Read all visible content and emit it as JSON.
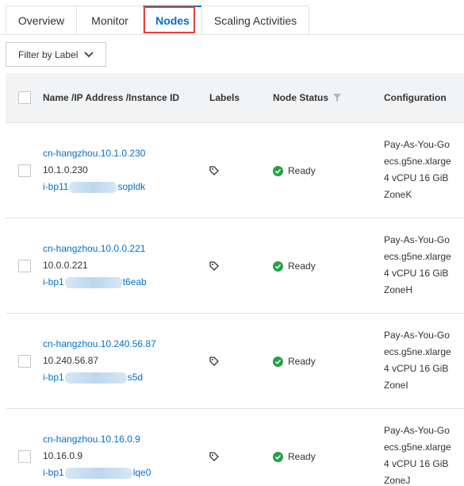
{
  "tabs": [
    {
      "label": "Overview"
    },
    {
      "label": "Monitor"
    },
    {
      "label": "Nodes",
      "active": true
    },
    {
      "label": "Scaling Activities"
    }
  ],
  "filter": {
    "label": "Filter by Label"
  },
  "columns": {
    "name": "Name /IP Address /Instance ID",
    "labels": "Labels",
    "status": "Node Status",
    "config": "Configuration"
  },
  "rows": [
    {
      "name": "cn-hangzhou.10.1.0.230",
      "ip": "10.1.0.230",
      "instance_prefix": "i-bp11",
      "instance_suffix": "sopldk",
      "status": "Ready",
      "config": [
        "Pay-As-You-Go",
        "ecs.g5ne.xlarge",
        "4 vCPU 16 GiB",
        "ZoneK"
      ]
    },
    {
      "name": "cn-hangzhou.10.0.0.221",
      "ip": "10.0.0.221",
      "instance_prefix": "i-bp1",
      "instance_suffix": "t6eab",
      "status": "Ready",
      "config": [
        "Pay-As-You-Go",
        "ecs.g5ne.xlarge",
        "4 vCPU 16 GiB",
        "ZoneH"
      ]
    },
    {
      "name": "cn-hangzhou.10.240.56.87",
      "ip": "10.240.56.87",
      "instance_prefix": "i-bp1",
      "instance_suffix": "s5d",
      "status": "Ready",
      "config": [
        "Pay-As-You-Go",
        "ecs.g5ne.xlarge",
        "4 vCPU 16 GiB",
        "ZoneI"
      ]
    },
    {
      "name": "cn-hangzhou.10.16.0.9",
      "ip": "10.16.0.9",
      "instance_prefix": "i-bp1",
      "instance_suffix": "lqe0",
      "status": "Ready",
      "config": [
        "Pay-As-You-Go",
        "ecs.g5ne.xlarge",
        "4 vCPU 16 GiB",
        "ZoneJ"
      ]
    }
  ],
  "colors": {
    "accent": "#0070cc",
    "highlight": "#e0433c",
    "ready": "#24a148",
    "header_bg": "#f2f3f5"
  },
  "icons": {
    "filter_chevron": "chevron-down-icon",
    "label_tag": "tag-icon",
    "status_filter": "funnel-icon",
    "ready": "check-circle-icon"
  }
}
